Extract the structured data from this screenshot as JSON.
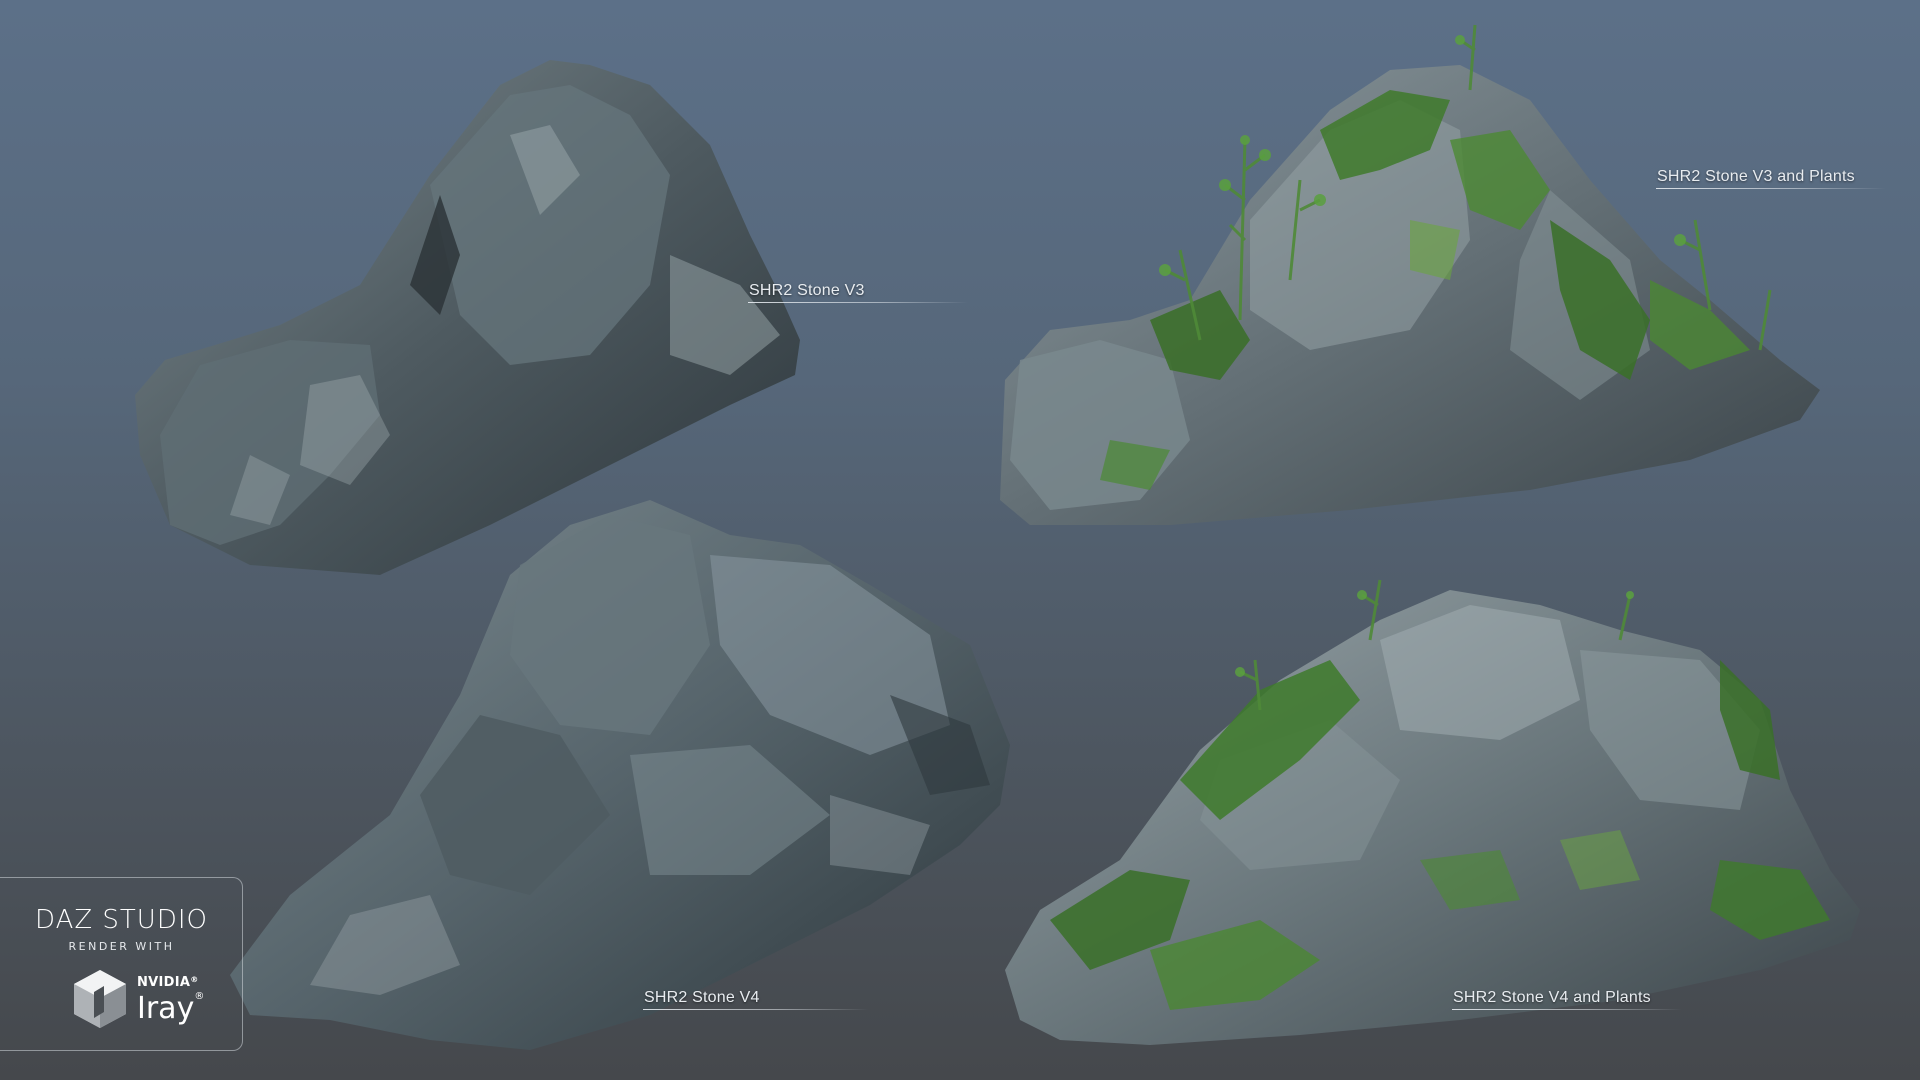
{
  "labels": {
    "stone_v3": "SHR2 Stone V3",
    "stone_v3_plants": "SHR2 Stone V3 and Plants",
    "stone_v4": "SHR2 Stone V4",
    "stone_v4_plants": "SHR2 Stone V4 and Plants"
  },
  "badge": {
    "title": "DAZ STUDIO",
    "subtitle": "RENDER WITH",
    "brand": "NVIDIA",
    "brand_mark": "®",
    "product": "Iray",
    "product_mark": "®",
    "icon": "nvidia-iray-cube-icon"
  },
  "colors": {
    "rock_dark": "#2f3a40",
    "rock_mid": "#5d6b72",
    "rock_light": "#9aa6aa",
    "moss": "#3f7a2c",
    "moss_light": "#6aa53f",
    "label_text": "#e8ecf0"
  }
}
